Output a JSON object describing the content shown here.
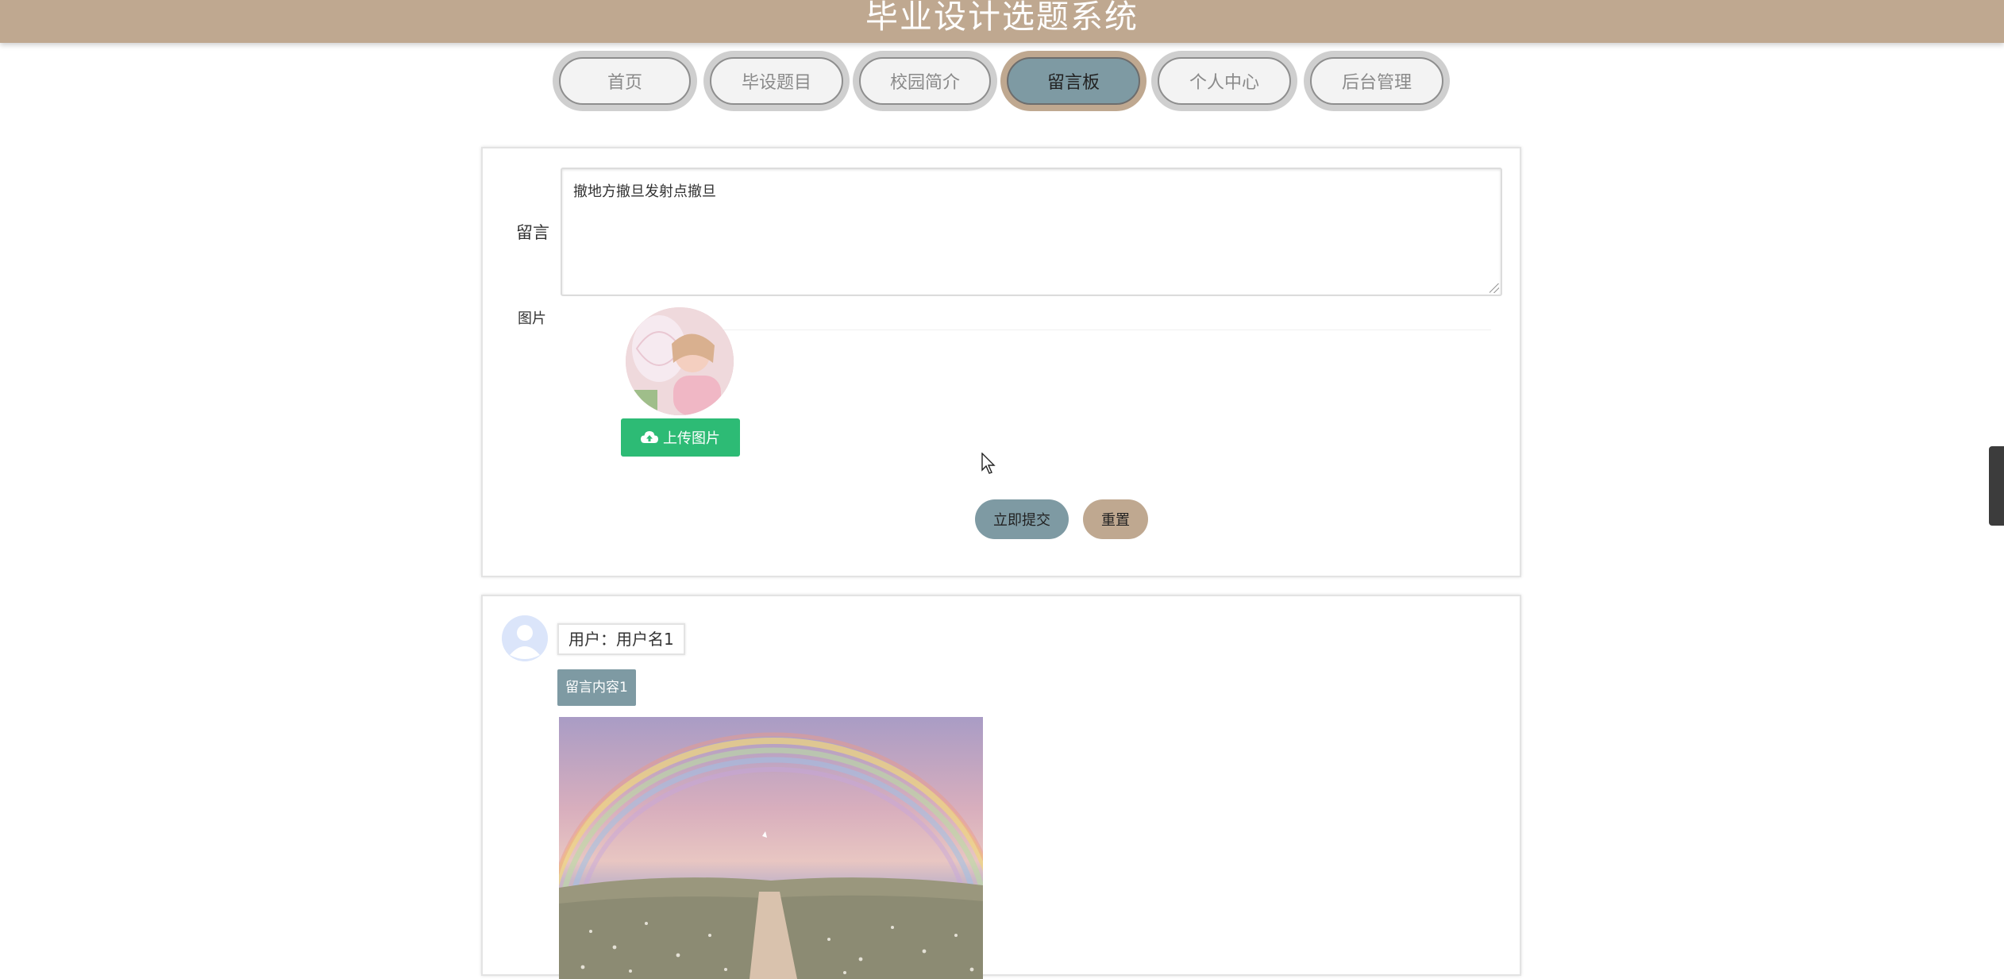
{
  "header": {
    "title": "毕业设计选题系统"
  },
  "nav": {
    "items": [
      {
        "label": "首页",
        "active": false
      },
      {
        "label": "毕设题目",
        "active": false
      },
      {
        "label": "校园简介",
        "active": false
      },
      {
        "label": "留言板",
        "active": true
      },
      {
        "label": "个人中心",
        "active": false
      },
      {
        "label": "后台管理",
        "active": false
      }
    ]
  },
  "form": {
    "message_label": "留言",
    "message_value": "撤地方撤旦发射点撤旦",
    "image_label": "图片",
    "upload_label": "上传图片",
    "submit_label": "立即提交",
    "reset_label": "重置"
  },
  "messages": [
    {
      "user_label": "用户：用户名1",
      "content": "留言内容1"
    }
  ],
  "colors": {
    "header_bg": "#bfa890",
    "active_nav": "#7e9aa3",
    "upload_green": "#2dbb75"
  }
}
